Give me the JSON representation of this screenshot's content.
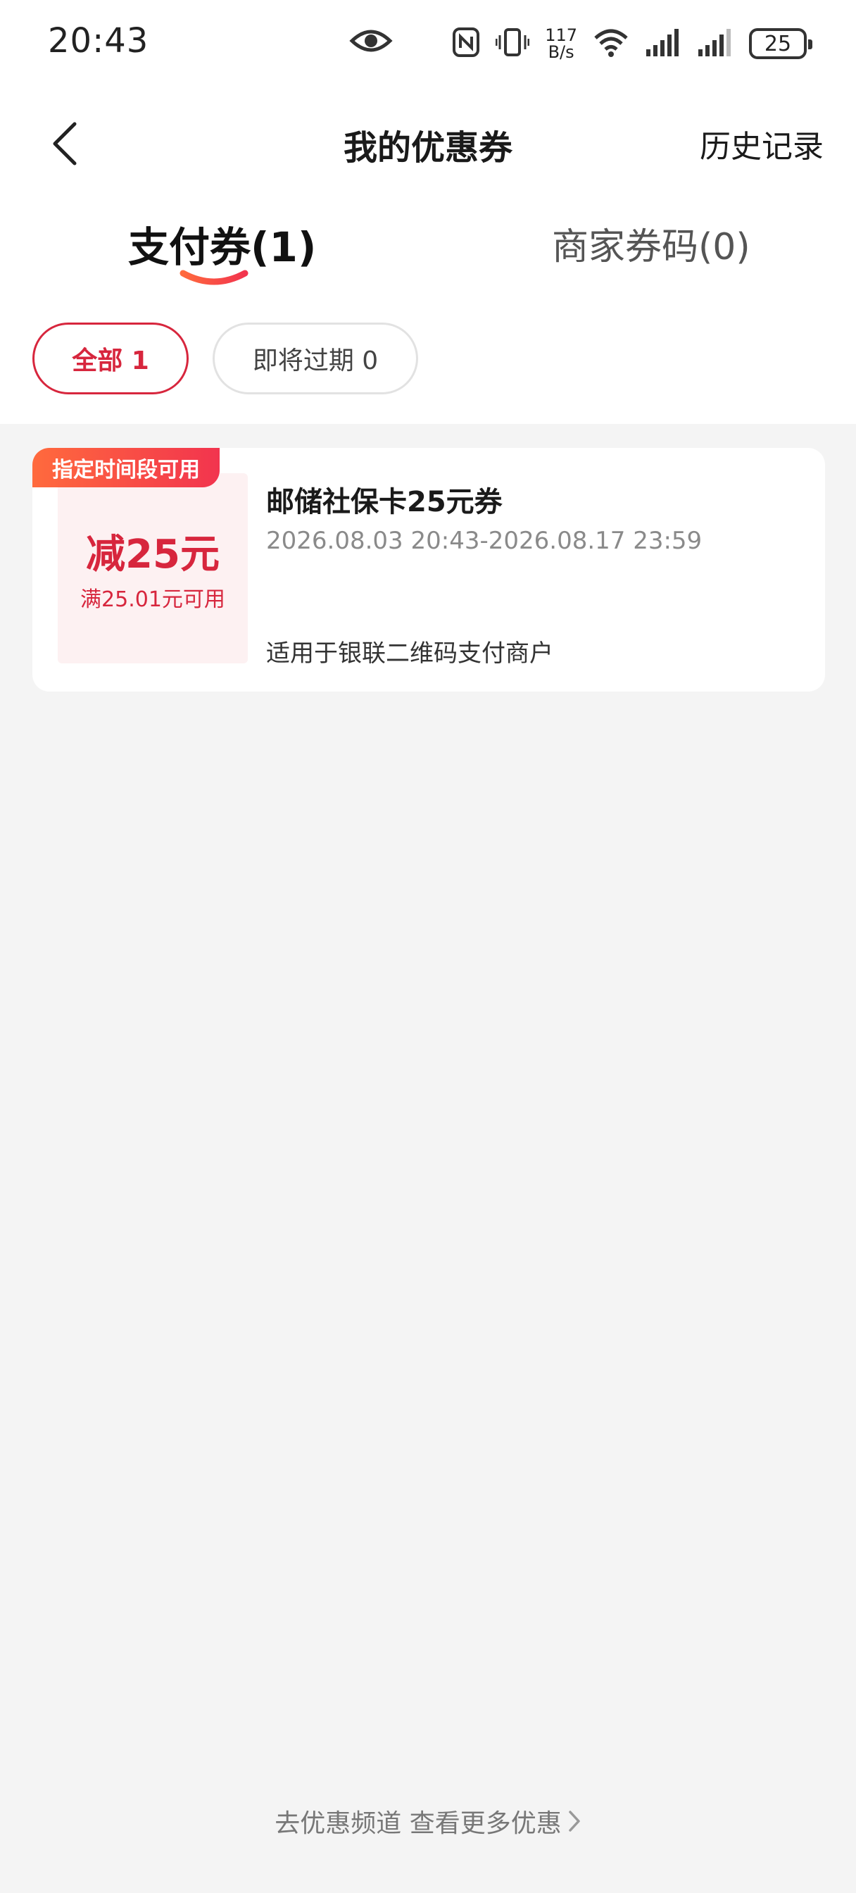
{
  "status_bar": {
    "time": "20:43",
    "speed_value": "117",
    "speed_unit": "B/s",
    "battery": "25",
    "icons": [
      "eye-icon",
      "nfc-icon",
      "vibrate-icon",
      "wifi-icon",
      "signal-icon",
      "signal-icon",
      "battery-icon"
    ]
  },
  "nav": {
    "title": "我的优惠券",
    "history": "历史记录",
    "back_icon": "chevron-left-icon"
  },
  "tabs": [
    {
      "label": "支付券(1)",
      "active": true
    },
    {
      "label": "商家券码(0)",
      "active": false
    }
  ],
  "filters": [
    {
      "label": "全部 1",
      "active": true
    },
    {
      "label": "即将过期 0",
      "active": false
    }
  ],
  "coupon": {
    "tag": "指定时间段可用",
    "amount": "减25元",
    "condition": "满25.01元可用",
    "name": "邮储社保卡25元券",
    "validity": "2026.08.03 20:43-2026.08.17 23:59",
    "scope": "适用于银联二维码支付商户"
  },
  "footer": {
    "link": "去优惠频道 查看更多优惠",
    "icon": "chevron-right-icon"
  },
  "colors": {
    "accent": "#d7263d",
    "tag_start": "#ff6a3d",
    "tag_end": "#f2344e",
    "background": "#f4f4f4"
  }
}
